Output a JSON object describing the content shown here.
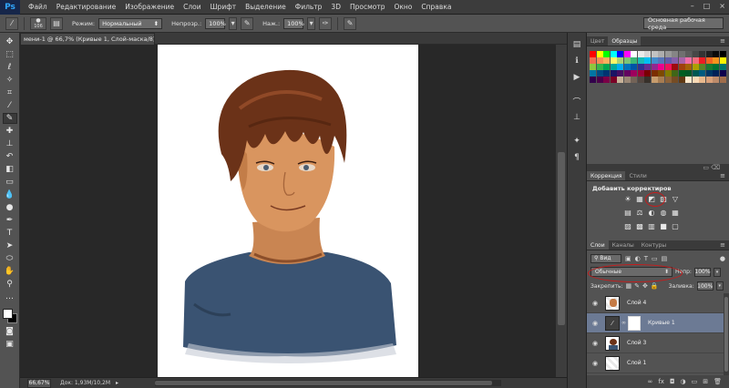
{
  "app": {
    "logo": "Ps"
  },
  "menu": {
    "items": [
      "Файл",
      "Редактирование",
      "Изображение",
      "Слои",
      "Шрифт",
      "Выделение",
      "Фильтр",
      "3D",
      "Просмотр",
      "Окно",
      "Справка"
    ],
    "window_controls": [
      "–",
      "□",
      "×"
    ]
  },
  "options": {
    "brush_size": "106",
    "mode_label": "Режим:",
    "mode_value": "Нормальный",
    "opacity_label": "Непрозр.:",
    "opacity_value": "100%",
    "flow_label": "Наж.:",
    "flow_value": "100%",
    "workspace": "Основная рабочая среда"
  },
  "document": {
    "tab_title": "мени-1 @ 66,7% (Кривые 1, Слой-маска/8) *",
    "tab_close": "×",
    "zoom": "66,67%",
    "info": "Док: 1,93М/10,2М",
    "status_arrow": "▸"
  },
  "swatches_panel": {
    "tabs": [
      "Цвет",
      "Образцы"
    ],
    "active_tab": 1,
    "colors": [
      "#ff0000",
      "#ffff00",
      "#00ff00",
      "#00ffff",
      "#0000ff",
      "#ff00ff",
      "#ffffff",
      "#ebebeb",
      "#d6d6d6",
      "#c2c2c2",
      "#adadad",
      "#999999",
      "#858585",
      "#707070",
      "#5c5c5c",
      "#474747",
      "#333333",
      "#1f1f1f",
      "#0a0a0a",
      "#000000",
      "#f26c4f",
      "#f68e56",
      "#fbaf5d",
      "#fff568",
      "#acd373",
      "#7cc576",
      "#3bb878",
      "#1abbb4",
      "#00bff3",
      "#438ccb",
      "#5574b9",
      "#605ca8",
      "#855fa8",
      "#a763a8",
      "#f06ea9",
      "#f26d7d",
      "#ed1c24",
      "#f26522",
      "#f7941d",
      "#fff200",
      "#8dc73f",
      "#39b54a",
      "#00a651",
      "#00a99d",
      "#00aeef",
      "#0072bc",
      "#0054a6",
      "#2e3192",
      "#662d91",
      "#92278f",
      "#ec008c",
      "#ed145b",
      "#9e0b0f",
      "#a0410d",
      "#a36209",
      "#aba000",
      "#598527",
      "#1a7b30",
      "#007236",
      "#00746b",
      "#0076a3",
      "#004b80",
      "#003471",
      "#1b1464",
      "#440e62",
      "#630460",
      "#9e005d",
      "#9e0039",
      "#790000",
      "#7b2e00",
      "#7d4900",
      "#827b00",
      "#406618",
      "#005e20",
      "#005826",
      "#005952",
      "#005b7f",
      "#003663",
      "#002157",
      "#0d004c",
      "#32004b",
      "#4b0049",
      "#7b0046",
      "#7a0026",
      "#c7b299",
      "#998675",
      "#736357",
      "#534741",
      "#37302a",
      "#c69c6d",
      "#a67c52",
      "#8c6239",
      "#754c24",
      "#603913",
      "#ffe9cd",
      "#f8d9b6",
      "#e8b98d",
      "#d9a17a",
      "#bd8b6a",
      "#a06d4b"
    ]
  },
  "adjust_panel": {
    "tabs": [
      "Коррекция",
      "Стили"
    ],
    "active_tab": 0,
    "title": "Добавить корректиров",
    "row1": [
      "☀",
      "▦",
      "◩",
      "▧",
      "▽"
    ],
    "row2": [
      "▤",
      "⚖",
      "◐",
      "◍",
      "▦"
    ],
    "row3": [
      "▨",
      "▩",
      "▥",
      "■",
      "▢"
    ]
  },
  "layers_panel": {
    "tabs": [
      "Слои",
      "Каналы",
      "Контуры"
    ],
    "active_tab": 0,
    "filter_value": "Вид",
    "blend_mode": "Обычные",
    "opacity_label": "Непр:",
    "opacity_value": "100%",
    "lock_label": "Закрепить:",
    "fill_label": "Заливка:",
    "fill_value": "100%",
    "layers": [
      {
        "name": "Слой 4",
        "visible": true,
        "selected": false
      },
      {
        "name": "Кривые 1",
        "visible": true,
        "selected": true
      },
      {
        "name": "Слой 3",
        "visible": true,
        "selected": false
      },
      {
        "name": "Слой 1",
        "visible": true,
        "selected": false
      }
    ],
    "bottom_icons": [
      "∞",
      "fx",
      "◘",
      "◑",
      "▭",
      "⊞",
      "🗑"
    ]
  },
  "colors": {
    "shirt": "#3a5372",
    "hair": "#6b3218",
    "skin": "#d9955f",
    "annotation_red": "#c81b1b"
  }
}
